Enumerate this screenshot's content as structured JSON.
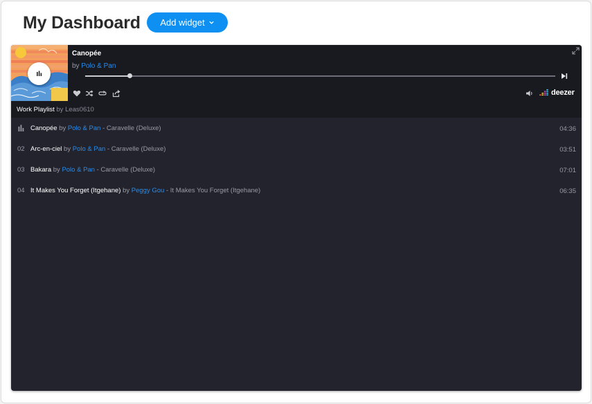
{
  "header": {
    "title": "My Dashboard",
    "add_widget_label": "Add widget"
  },
  "player": {
    "track_title": "Canopée",
    "by_label": "by",
    "artist": "Polo & Pan",
    "progress_fraction": 0.095,
    "brand": "deezer",
    "playlist_name": "Work Playlist",
    "playlist_by": "by",
    "playlist_owner": "Leas0610",
    "tracks": [
      {
        "num": "",
        "playing": true,
        "title": "Canopée",
        "by": "by",
        "artist": "Polo & Pan",
        "album": "- Caravelle (Deluxe)",
        "duration": "04:36"
      },
      {
        "num": "02",
        "playing": false,
        "title": "Arc-en-ciel",
        "by": "by",
        "artist": "Polo & Pan",
        "album": "- Caravelle (Deluxe)",
        "duration": "03:51"
      },
      {
        "num": "03",
        "playing": false,
        "title": "Bakara",
        "by": "by",
        "artist": "Polo & Pan",
        "album": "- Caravelle (Deluxe)",
        "duration": "07:01"
      },
      {
        "num": "04",
        "playing": false,
        "title": "It Makes You Forget (Itgehane)",
        "by": "by",
        "artist": "Peggy Gou",
        "album": "- It Makes You Forget (Itgehane)",
        "duration": "06:35"
      }
    ]
  },
  "colors": {
    "accent": "#0e8ff2",
    "link": "#2a8ce8",
    "widget_bg": "#23232d",
    "header_bg": "#191920"
  },
  "icons": [
    "chevron-down-icon",
    "pause-icon",
    "next-icon",
    "expand-icon",
    "heart-icon",
    "shuffle-icon",
    "repeat-icon",
    "share-icon",
    "volume-icon",
    "deezer-logo",
    "equalizer-icon"
  ]
}
